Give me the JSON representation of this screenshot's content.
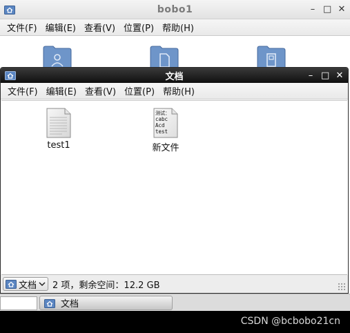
{
  "back_window": {
    "title": "bobo1",
    "menu": [
      "文件(F)",
      "编辑(E)",
      "查看(V)",
      "位置(P)",
      "帮助(H)"
    ]
  },
  "front_window": {
    "title": "文档",
    "menu": [
      "文件(F)",
      "编辑(E)",
      "查看(V)",
      "位置(P)",
      "帮助(H)"
    ],
    "files": [
      {
        "name": "test1",
        "icon": "text-file-icon",
        "preview_lines": []
      },
      {
        "name": "新文件",
        "icon": "text-file-preview-icon",
        "preview_lines": [
          "测试：",
          "cabc",
          "Acd",
          "test"
        ]
      }
    ],
    "statusbar": {
      "location": "文档",
      "status": "2 项，剩余空间：12.2 GB"
    }
  },
  "taskbar": {
    "task_label": "文档"
  },
  "watermark": "CSDN @bcbobo21cn",
  "colors": {
    "folder_blue": "#6e95c9",
    "titlebar_dark": "#1a1a1a"
  }
}
